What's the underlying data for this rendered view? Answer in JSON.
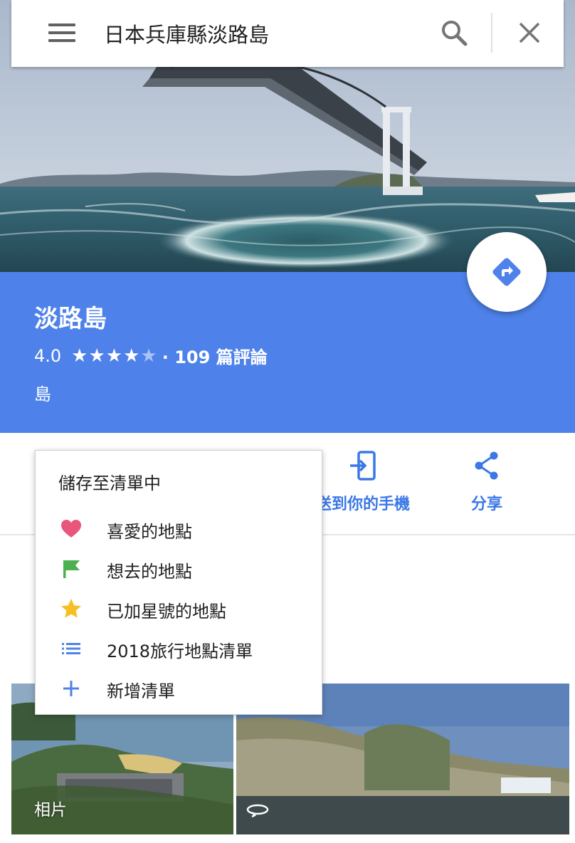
{
  "search": {
    "query": "日本兵庫縣淡路島"
  },
  "place": {
    "name": "淡路島",
    "rating": "4.0",
    "stars_filled": 4,
    "stars_total": 5,
    "reviews": "· 109 篇評論",
    "type": "島"
  },
  "route": {
    "label": "規劃路線"
  },
  "actions": {
    "send_to_phone": "送到你的手機",
    "share": "分享"
  },
  "photos": {
    "photos_label": "相片"
  },
  "save_menu": {
    "title": "儲存至清單中",
    "items": [
      {
        "label": "喜愛的地點",
        "icon": "heart-icon",
        "color": "#e8577b"
      },
      {
        "label": "想去的地點",
        "icon": "flag-icon",
        "color": "#4caf50"
      },
      {
        "label": "已加星號的地點",
        "icon": "star-icon",
        "color": "#f6bf26"
      },
      {
        "label": "2018旅行地點清單",
        "icon": "list-icon",
        "color": "#4e82ea"
      },
      {
        "label": "新增清單",
        "icon": "plus-icon",
        "color": "#4e82ea"
      }
    ]
  },
  "colors": {
    "brand_blue": "#4e82ea",
    "link_blue": "#3b78e7"
  }
}
